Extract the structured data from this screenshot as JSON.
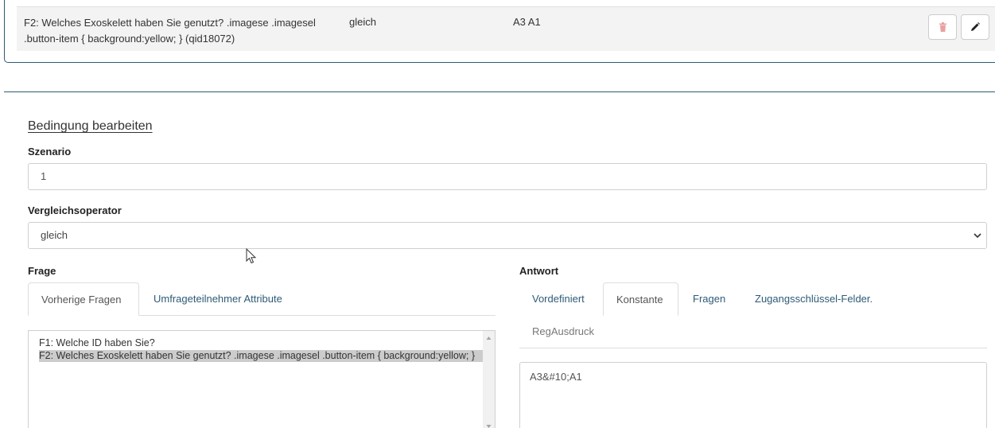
{
  "condition": {
    "question": "F2: Welches Exoskelett haben Sie genutzt? .imagese .imagesel .button-item { background:yellow; } (qid18072)",
    "operator": "gleich",
    "answer": "A3 A1",
    "delete_icon": "trash-icon",
    "edit_icon": "pencil-icon"
  },
  "edit_form": {
    "title": "Bedingung bearbeiten",
    "scenario_label": "Szenario",
    "scenario_value": "1",
    "operator_label": "Vergleichsoperator",
    "operator_value": "gleich",
    "question_label": "Frage",
    "answer_label": "Antwort"
  },
  "question_tabs": [
    {
      "label": "Vorherige Fragen",
      "active": true
    },
    {
      "label": "Umfrageteilnehmer Attribute",
      "active": false
    }
  ],
  "question_list": [
    {
      "label": "F1: Welche ID haben Sie?",
      "selected": false
    },
    {
      "label": "F2: Welches Exoskelett haben Sie genutzt? .imagese .imagesel .button-item { background:yellow; }",
      "selected": true
    }
  ],
  "answer_tabs": [
    {
      "label": "Vordefiniert",
      "active": false
    },
    {
      "label": "Konstante",
      "active": true
    },
    {
      "label": "Fragen",
      "active": false
    },
    {
      "label": "Zugangsschlüssel-Felder.",
      "active": false
    },
    {
      "label": "RegAusdruck",
      "active": false
    }
  ],
  "answer_value": "A3&#10;A1",
  "colors": {
    "border_accent": "#2e5b76",
    "link": "#2e5b76",
    "delete_icon": "#e8a2a2"
  }
}
